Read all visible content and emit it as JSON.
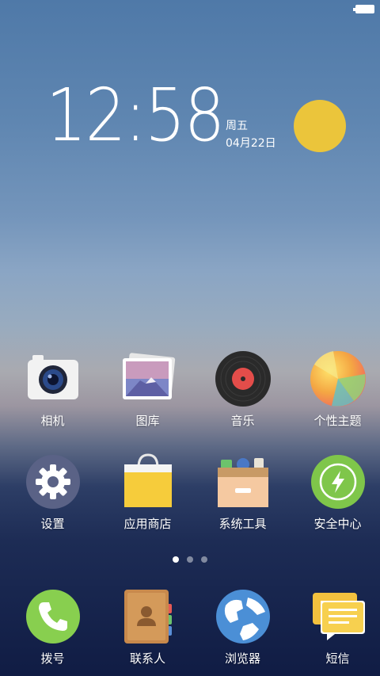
{
  "status": {
    "battery_icon": "battery-full-icon"
  },
  "lockscreen": {
    "time": "12:58",
    "weekday": "周五",
    "date": "04月22日",
    "weather_icon": "sun-icon",
    "weather_color": "#EBC53B"
  },
  "apps": {
    "row1": [
      {
        "label": "相机",
        "icon": "camera-icon"
      },
      {
        "label": "图库",
        "icon": "gallery-icon"
      },
      {
        "label": "音乐",
        "icon": "music-icon"
      },
      {
        "label": "个性主题",
        "icon": "theme-icon"
      }
    ],
    "row2": [
      {
        "label": "设置",
        "icon": "settings-icon"
      },
      {
        "label": "应用商店",
        "icon": "app-store-icon"
      },
      {
        "label": "系统工具",
        "icon": "system-tools-icon"
      },
      {
        "label": "安全中心",
        "icon": "security-center-icon"
      }
    ]
  },
  "pager": {
    "pages": 3,
    "current": 1
  },
  "dock": [
    {
      "label": "拨号",
      "icon": "phone-icon"
    },
    {
      "label": "联系人",
      "icon": "contacts-icon"
    },
    {
      "label": "浏览器",
      "icon": "browser-icon"
    },
    {
      "label": "短信",
      "icon": "messages-icon"
    }
  ]
}
